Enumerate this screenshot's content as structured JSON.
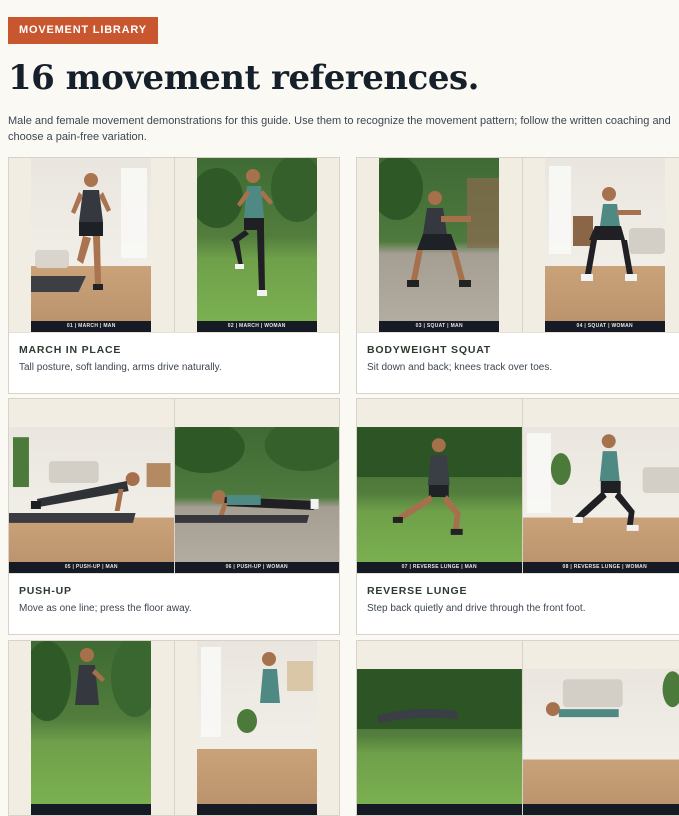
{
  "header": {
    "badge": "MOVEMENT LIBRARY",
    "title": "16 movement references.",
    "intro": "Male and female movement demonstrations for this guide. Use them to recognize the movement pattern; follow the written coaching and choose a pain-free variation."
  },
  "cards": [
    {
      "title": "MARCH IN PLACE",
      "description": "Tall posture, soft landing, arms drive naturally.",
      "photos": [
        {
          "caption": "01 | MARCH | MAN",
          "scene": "indoor"
        },
        {
          "caption": "02 | MARCH | WOMAN",
          "scene": "garden"
        }
      ]
    },
    {
      "title": "BODYWEIGHT SQUAT",
      "description": "Sit down and back; knees track over toes.",
      "photos": [
        {
          "caption": "03 | SQUAT | MAN",
          "scene": "patio"
        },
        {
          "caption": "04 | SQUAT | WOMAN",
          "scene": "indoor"
        }
      ]
    },
    {
      "title": "PUSH-UP",
      "description": "Move as one line; press the floor away.",
      "photos": [
        {
          "caption": "05 | PUSH-UP | MAN",
          "scene": "indoor"
        },
        {
          "caption": "06 | PUSH-UP | WOMAN",
          "scene": "patio"
        }
      ]
    },
    {
      "title": "REVERSE LUNGE",
      "description": "Step back quietly and drive through the front foot.",
      "photos": [
        {
          "caption": "07 | REVERSE LUNGE | MAN",
          "scene": "garden"
        },
        {
          "caption": "08 | REVERSE LUNGE | WOMAN",
          "scene": "indoor"
        }
      ]
    },
    {
      "title": "",
      "description": "",
      "photos": [
        {
          "caption": "",
          "scene": "garden"
        },
        {
          "caption": "",
          "scene": "indoor"
        }
      ]
    },
    {
      "title": "",
      "description": "",
      "photos": [
        {
          "caption": "",
          "scene": "garden"
        },
        {
          "caption": "",
          "scene": "indoor"
        }
      ]
    }
  ],
  "colors": {
    "accent": "#c8562f",
    "page_background": "#fbf9f4",
    "caption_bar": "#151a24"
  }
}
